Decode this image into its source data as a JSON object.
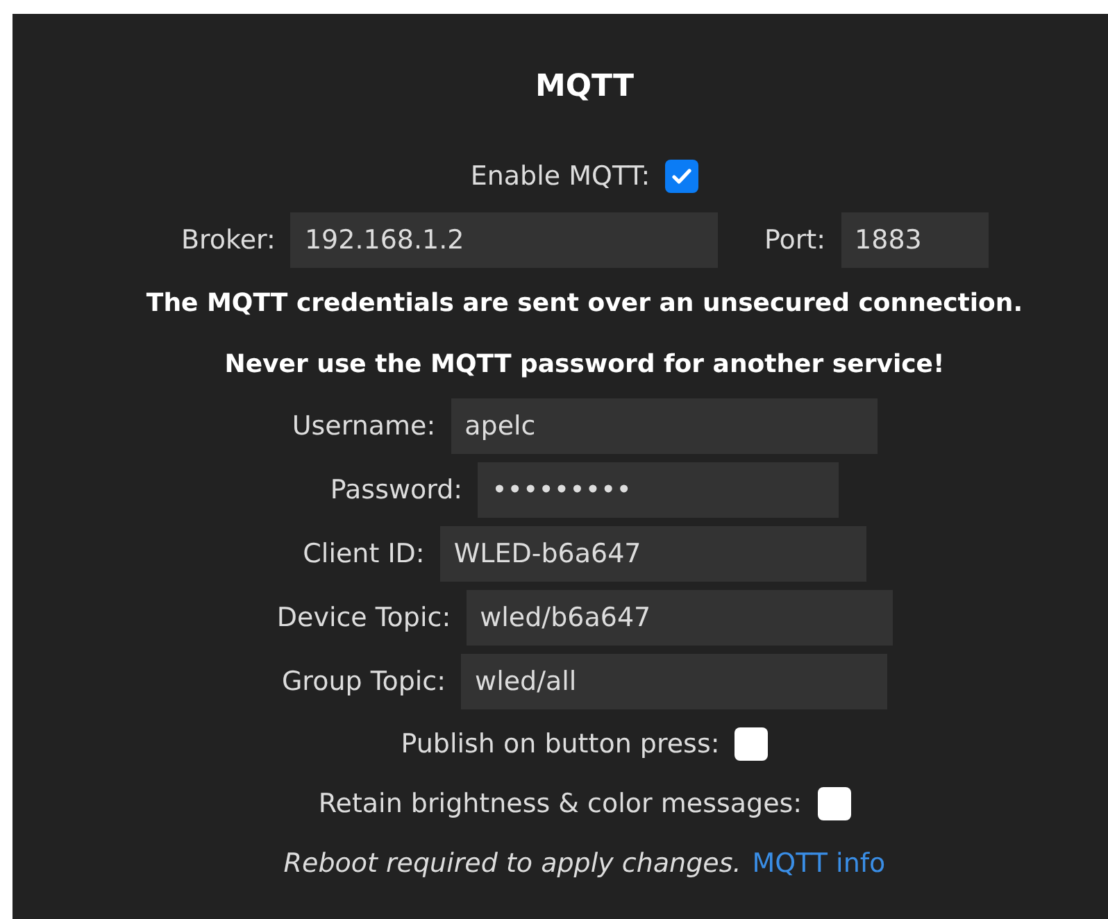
{
  "title": "MQTT",
  "enable": {
    "label": "Enable MQTT:",
    "checked": true
  },
  "broker_row": [
    {
      "label": "Broker:",
      "value": "192.168.1.2"
    },
    {
      "label": "Port:",
      "value": "1883"
    }
  ],
  "warnings": [
    "The MQTT credentials are sent over an unsecured connection.",
    "Never use the MQTT password for another service!"
  ],
  "fields": [
    {
      "label": "Username:",
      "value": "apelc"
    },
    {
      "label": "Password:",
      "value": "•••••••••"
    },
    {
      "label": "Client ID:",
      "value": "WLED-b6a647"
    },
    {
      "label": "Device Topic:",
      "value": "wled/b6a647"
    },
    {
      "label": "Group Topic:",
      "value": "wled/all"
    }
  ],
  "options": [
    {
      "label": "Publish on button press:",
      "checked": false
    },
    {
      "label": "Retain brightness & color messages:",
      "checked": false
    }
  ],
  "footer": {
    "note": "Reboot required to apply changes.",
    "link": "MQTT info"
  }
}
